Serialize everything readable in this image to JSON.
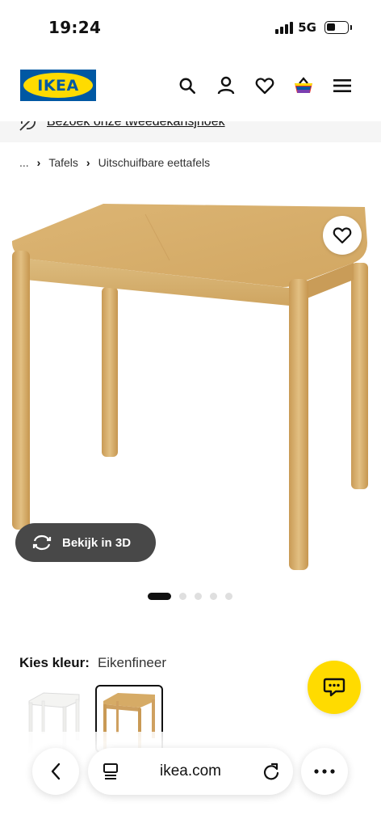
{
  "status_bar": {
    "time": "19:24",
    "network": "5G"
  },
  "header": {
    "logo_text": "IKEA",
    "brand_blue": "#0058a3",
    "brand_yellow": "#ffdb00"
  },
  "promo": {
    "link_text": "Bezoek onze tweedekansjhoek"
  },
  "breadcrumb": {
    "ellipsis": "...",
    "items": [
      "Tafels",
      "Uitschuifbare eettafels"
    ]
  },
  "product": {
    "view_3d_label": "Bekijk in 3D",
    "image_count": 5,
    "active_image": 1
  },
  "color": {
    "label": "Kies kleur:",
    "value": "Eikenfineer"
  },
  "browser": {
    "url": "ikea.com"
  },
  "icons": [
    "search-icon",
    "user-icon",
    "heart-icon",
    "cart-icon",
    "menu-icon",
    "recycle-icon",
    "rotate-3d-icon",
    "chat-icon",
    "back-icon",
    "tabs-icon",
    "reload-icon",
    "more-icon"
  ]
}
